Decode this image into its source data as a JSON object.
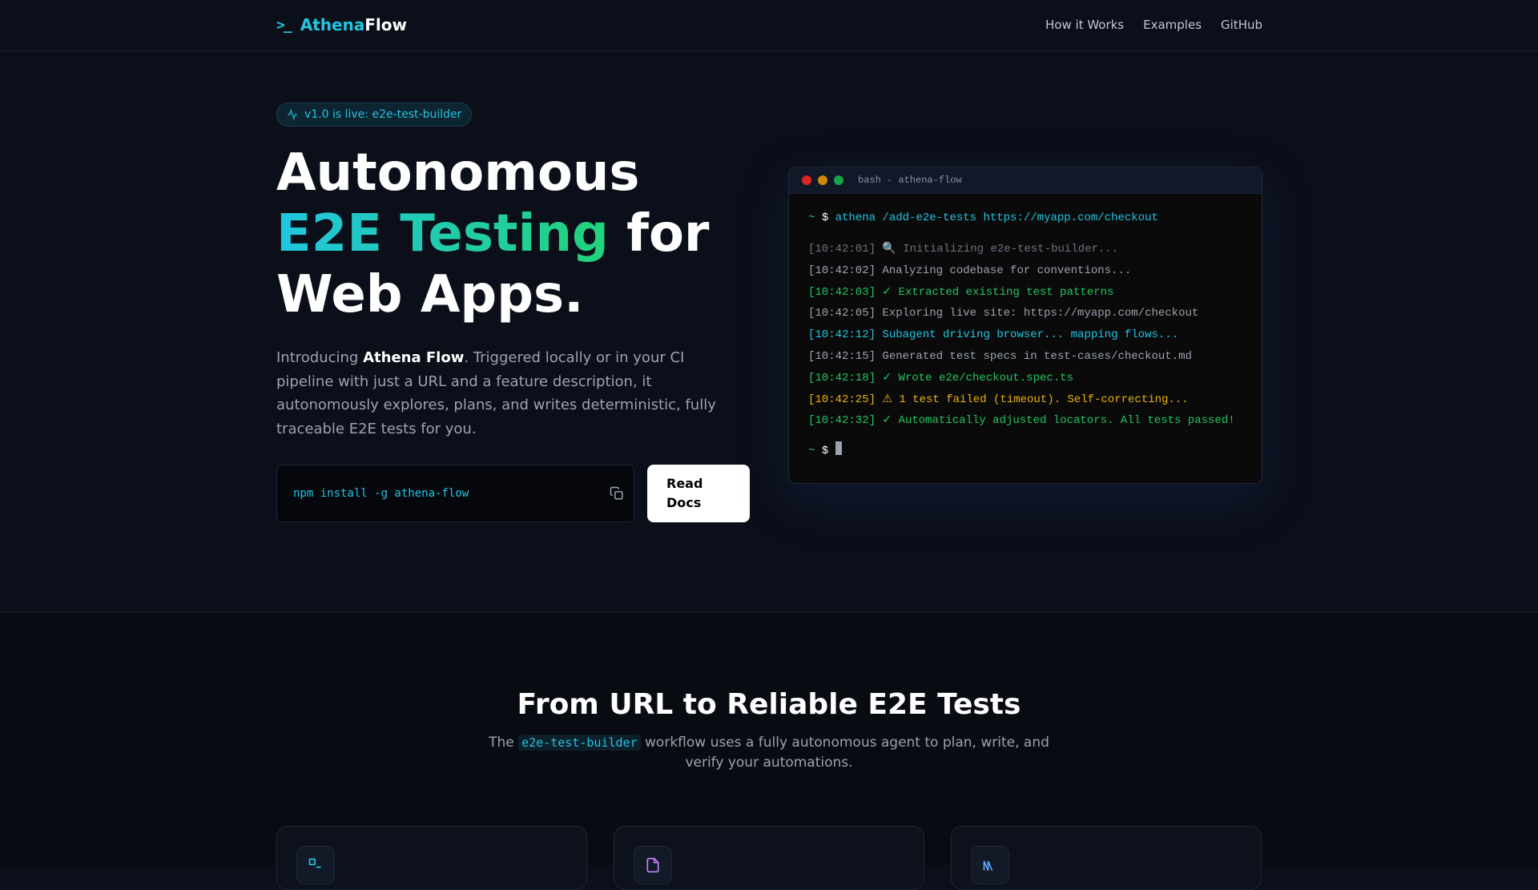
{
  "nav": {
    "logo_prefix": "Athena",
    "logo_suffix": "Flow",
    "logo_icon": ">_",
    "links": [
      "How it Works",
      "Examples",
      "GitHub"
    ]
  },
  "hero": {
    "badge": "v1.0 is live: e2e-test-builder",
    "title_line1": "Autonomous",
    "title_highlight": "E2E Testing",
    "title_for": " for",
    "title_line3": "Web Apps.",
    "para_pre": "Introducing ",
    "para_bold": "Athena Flow",
    "para_post": ". Triggered locally or in your CI pipeline with just a URL and a feature description, it autonomously explores, plans, and writes deterministic, fully traceable E2E tests for you.",
    "install_cmd": "npm install -g athena-flow",
    "docs_label": "Read Docs"
  },
  "terminal": {
    "title": "bash - athena-flow",
    "prompt": "~",
    "dollar": "$",
    "command": "athena /add-e2e-tests https://myapp.com/checkout",
    "lines": [
      {
        "ts": "[10:42:01]",
        "text": " 🔍 Initializing e2e-test-builder..."
      },
      {
        "ts": "[10:42:02]",
        "text": " Analyzing codebase for conventions..."
      },
      {
        "ts": "[10:42:03]",
        "text": " ✓ Extracted existing test patterns"
      },
      {
        "ts": "[10:42:05]",
        "text": " Exploring live site: https://myapp.com/checkout"
      },
      {
        "ts": "[10:42:12]",
        "text": " Subagent driving browser... mapping flows..."
      },
      {
        "ts": "[10:42:15]",
        "text": " Generated test specs in test-cases/checkout.md"
      },
      {
        "ts": "[10:42:18]",
        "text": " ✓ Wrote e2e/checkout.spec.ts"
      },
      {
        "ts": "[10:42:25]",
        "text": " ⚠ 1 test failed (timeout). Self-correcting..."
      },
      {
        "ts": "[10:42:32]",
        "text": " ✓ Automatically adjusted locators. All tests passed!"
      }
    ]
  },
  "section": {
    "title": "From URL to Reliable E2E Tests",
    "sub_pre": "The ",
    "sub_code": "e2e-test-builder",
    "sub_post": " workflow uses a fully autonomous agent to plan, write, and verify your automations."
  },
  "colors": {
    "accent": "#22c5e0",
    "green": "#22c55e",
    "yellow": "#eab308"
  }
}
